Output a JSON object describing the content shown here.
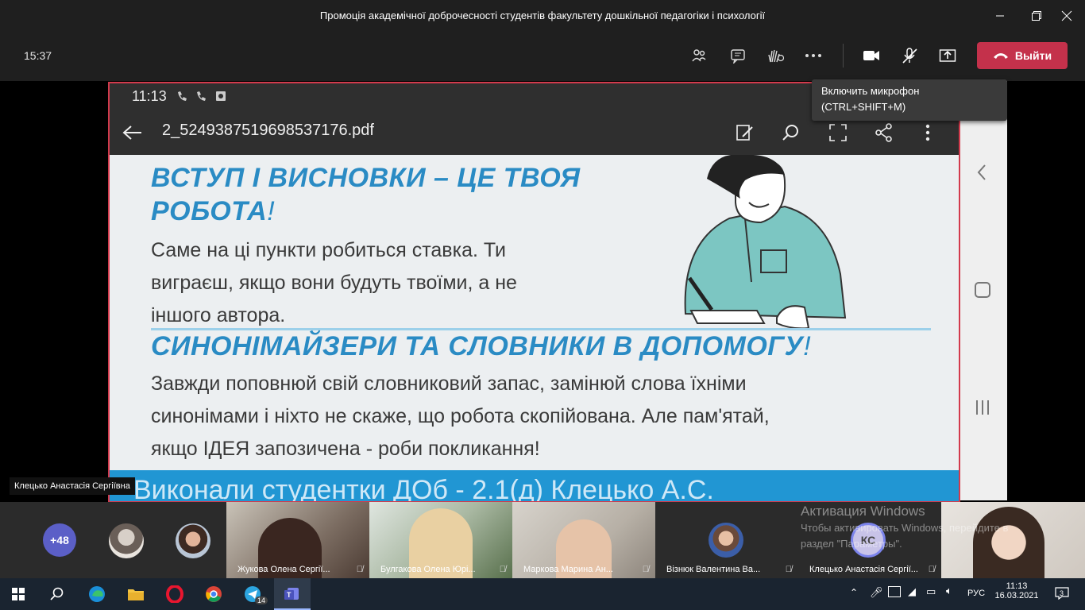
{
  "window": {
    "title": "Промоція академічної доброчесності студентів факультету дошкільної педагогіки і психології"
  },
  "meeting": {
    "time": "15:37",
    "leave_label": "Выйти",
    "tooltip_line1": "Включить микрофон",
    "tooltip_line2": "(CTRL+SHIFT+M)",
    "presenter_name": "Клецько Анастасія Сергіївна"
  },
  "shared_screen": {
    "status_time": "11:13",
    "file_name": "2_5249387519698537176.pdf",
    "heading1_line1": "ВСТУП І ВИСНОВКИ – ЦЕ ТВОЯ",
    "heading1_line2": "РОБОТА",
    "heading1_mark": "!",
    "para1_line1": "Саме на ці пункти робиться ставка. Ти",
    "para1_line2": "виграєш, якщо вони будуть твоїми, а не",
    "para1_line3": "іншого автора.",
    "heading2": "СИНОНІМАЙЗЕРИ ТА СЛОВНИКИ В ДОПОМОГУ",
    "heading2_mark": "!",
    "para2_line1": "Завжди поповнюй свій словниковий запас, замінюй слова їхніми",
    "para2_line2": "синонімами і ніхто не скаже, що робота скопійована. Але пам'ятай,",
    "para2_line3": "якщо ІДЕЯ запозичена - роби покликання!",
    "footer_text": "Виконали   студентки   ДОб - 2.1(д)   Клецько  А.С."
  },
  "participants": {
    "overflow_count": "+48",
    "tiles": [
      {
        "name": "Жукова Олена Сергії..."
      },
      {
        "name": "Булгакова Олена Юрі..."
      },
      {
        "name": "Маркова Марина Ан..."
      },
      {
        "name": "Візнюк Валентина Ва..."
      },
      {
        "name": "Клецько Анастасія Сергії...",
        "initials": "КС"
      }
    ],
    "activation_line1": "Активация Windows",
    "activation_line2": "Чтобы активировать Windows, перейдите в",
    "activation_line3": "раздел \"Параметры\"."
  },
  "taskbar": {
    "telegram_badge": "14",
    "language": "РУС",
    "clock_time": "11:13",
    "clock_date": "16.03.2021",
    "notifications": "3"
  },
  "colors": {
    "leave": "#c4314b",
    "heading": "#2a8bc4",
    "footer": "#2196d3",
    "share_border": "#d23a4c",
    "taskbar": "#1a2430"
  }
}
